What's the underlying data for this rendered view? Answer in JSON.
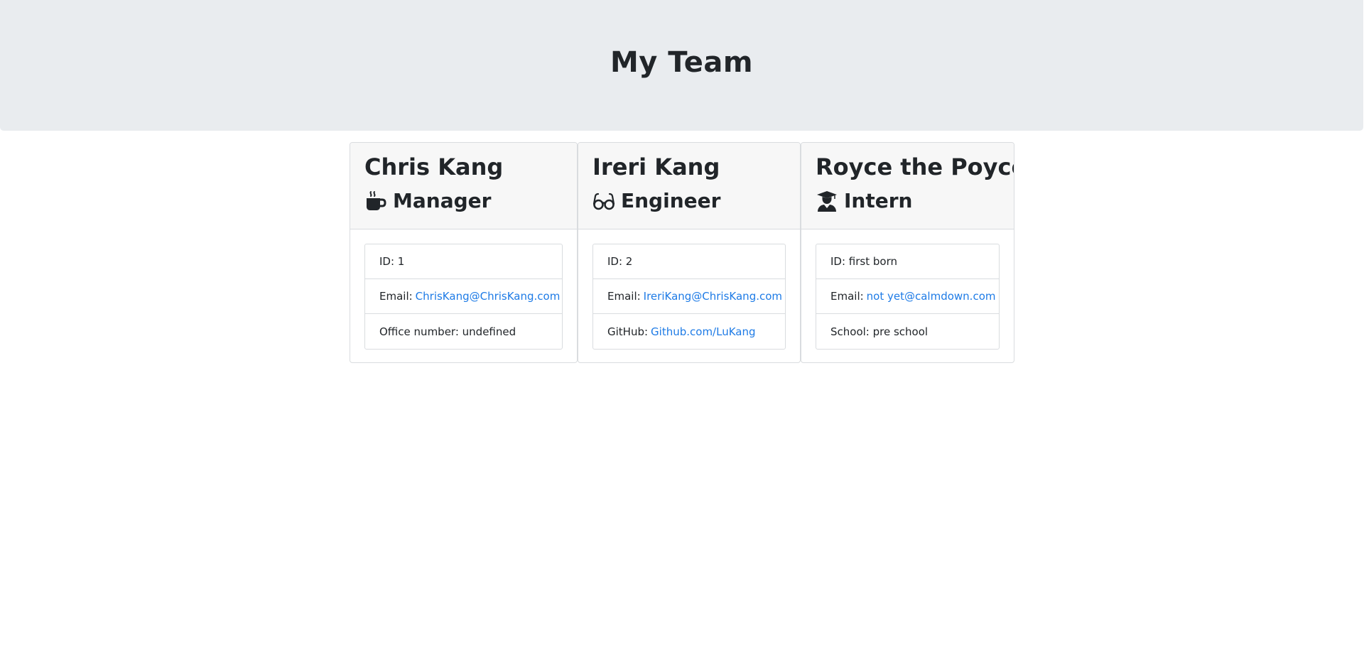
{
  "header": {
    "title": "My Team"
  },
  "team": [
    {
      "name": "Chris Kang",
      "role": "Manager",
      "icon": "coffee-mug-icon",
      "id_label": "ID: 1",
      "email_label": "Email:",
      "email": "ChrisKang@ChrisKang.com",
      "extra_label": "Office number: undefined"
    },
    {
      "name": "Ireri Kang",
      "role": "Engineer",
      "icon": "glasses-icon",
      "id_label": "ID: 2",
      "email_label": "Email:",
      "email": "IreriKang@ChrisKang.com",
      "extra_label": "GitHub:",
      "extra_link": "Github.com/LuKang"
    },
    {
      "name": "Royce the Poyce",
      "role": "Intern",
      "icon": "graduate-icon",
      "id_label": "ID: first born",
      "email_label": "Email:",
      "email": "not yet@calmdown.com",
      "extra_label": "School: pre school"
    }
  ],
  "colors": {
    "header_bg": "#e9ecef",
    "card_header_bg": "#f7f7f7",
    "link": "#1e7be6",
    "text": "#212529"
  }
}
